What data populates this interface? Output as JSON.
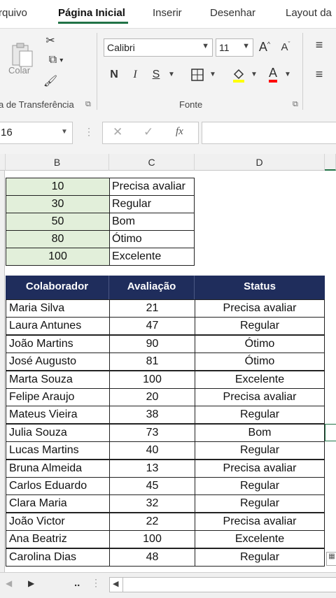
{
  "tabs": [
    "rquivo",
    "Página Inicial",
    "Inserir",
    "Desenhar",
    "Layout da"
  ],
  "ribbon": {
    "paste_label": "Colar",
    "clipboard_group": "a de Transferência",
    "font_group": "Fonte",
    "font_name": "Calibri",
    "font_size": "11",
    "bold": "N",
    "italic": "I",
    "underline": "S"
  },
  "formula_bar": {
    "name_box": "16",
    "fx": "fx",
    "formula": ""
  },
  "columns": [
    "B",
    "C",
    "D"
  ],
  "reference_table": [
    {
      "value": "10",
      "label": "Precisa avaliar"
    },
    {
      "value": "30",
      "label": "Regular"
    },
    {
      "value": "50",
      "label": "Bom"
    },
    {
      "value": "80",
      "label": "Ótimo"
    },
    {
      "value": "100",
      "label": "Excelente"
    }
  ],
  "main_table": {
    "headers": [
      "Colaborador",
      "Avaliação",
      "Status"
    ],
    "rows": [
      {
        "name": "Maria Silva",
        "score": "21",
        "status": "Precisa avaliar"
      },
      {
        "name": "Laura Antunes",
        "score": "47",
        "status": "Regular"
      },
      {
        "name": "João Martins",
        "score": "90",
        "status": "Ótimo"
      },
      {
        "name": "José Augusto",
        "score": "81",
        "status": "Ótimo"
      },
      {
        "name": "Marta Souza",
        "score": "100",
        "status": "Excelente"
      },
      {
        "name": "Felipe Araujo",
        "score": "20",
        "status": "Precisa avaliar"
      },
      {
        "name": "Mateus Vieira",
        "score": "38",
        "status": "Regular"
      },
      {
        "name": "Julia Souza",
        "score": "73",
        "status": "Bom"
      },
      {
        "name": "Lucas Martins",
        "score": "40",
        "status": "Regular"
      },
      {
        "name": "Bruna Almeida",
        "score": "13",
        "status": "Precisa avaliar"
      },
      {
        "name": "Carlos Eduardo",
        "score": "45",
        "status": "Regular"
      },
      {
        "name": "Clara Maria",
        "score": "32",
        "status": "Regular"
      },
      {
        "name": "João Victor",
        "score": "22",
        "status": "Precisa avaliar"
      },
      {
        "name": "Ana Beatriz",
        "score": "100",
        "status": "Excelente"
      },
      {
        "name": "Carolina Dias",
        "score": "48",
        "status": "Regular"
      }
    ]
  },
  "bottom": {
    "dots": ".."
  },
  "colors": {
    "accent": "#217346",
    "header_bg": "#1f2d5c",
    "ref_fill": "#e2efda"
  }
}
